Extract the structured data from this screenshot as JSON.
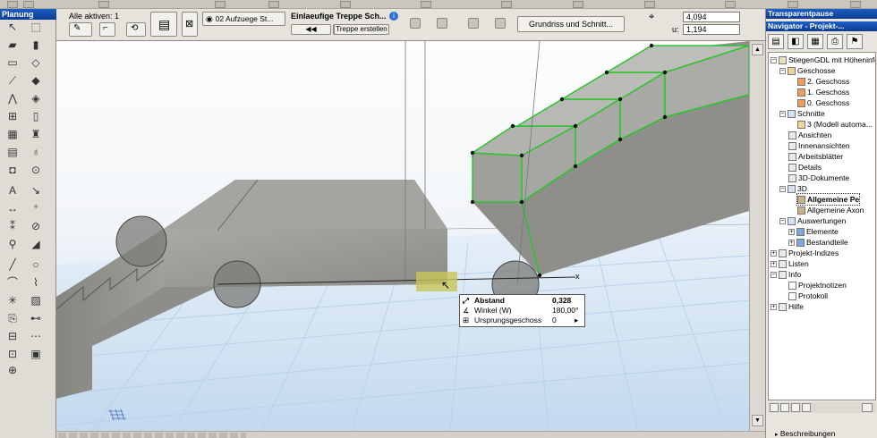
{
  "toolbox": {
    "title": "Planung"
  },
  "infobox": {
    "active_label": "Alle aktiven: 1",
    "layer_label": "02 Aufzuege St...",
    "stair_name": "Einlaeufige Treppe Sch...",
    "create_stair_label": "Treppe erstellen",
    "view_button_label": "Grundriss und Schnitt...",
    "coord_x": "4,094",
    "coord_u": "1,194",
    "coord_u_label": "u:"
  },
  "right_panel": {
    "palette_title": "Transparentpause",
    "navigator_title": "Navigator - Projekt-..."
  },
  "navigator": {
    "items": [
      {
        "label": "StiegenGDL mit Höheninfo"
      },
      {
        "label": "Geschosse"
      },
      {
        "label": "2. Geschoss"
      },
      {
        "label": "1. Geschoss"
      },
      {
        "label": "0. Geschoss"
      },
      {
        "label": "Schnitte"
      },
      {
        "label": "3 (Modell automa..."
      },
      {
        "label": "Ansichten"
      },
      {
        "label": "Innenansichten"
      },
      {
        "label": "Arbeitsblätter"
      },
      {
        "label": "Details"
      },
      {
        "label": "3D-Dokumente"
      },
      {
        "label": "3D"
      },
      {
        "label": "Allgemeine Pe"
      },
      {
        "label": "Allgemeine Axon"
      },
      {
        "label": "Auswertungen"
      },
      {
        "label": "Elemente"
      },
      {
        "label": "Bestandteile"
      },
      {
        "label": "Projekt-Indizes"
      },
      {
        "label": "Listen"
      },
      {
        "label": "Info"
      },
      {
        "label": "Projektnotizen"
      },
      {
        "label": "Protokoll"
      },
      {
        "label": "Hilfe"
      }
    ],
    "bottom_label": "Beschreibungen"
  },
  "tracker": {
    "rows": [
      {
        "label": "Abstand",
        "value": "0,328"
      },
      {
        "label": "Winkel (W)",
        "value": "180,00°"
      },
      {
        "label": "Ursprungsgeschoss",
        "value": "0"
      }
    ]
  },
  "canvas": {
    "axis_label": "x"
  },
  "colors": {
    "title_bar": "#0a3b93",
    "selection_green": "#2ec22e",
    "concrete": "#9a9a96",
    "grid": "#b9d2ea"
  }
}
